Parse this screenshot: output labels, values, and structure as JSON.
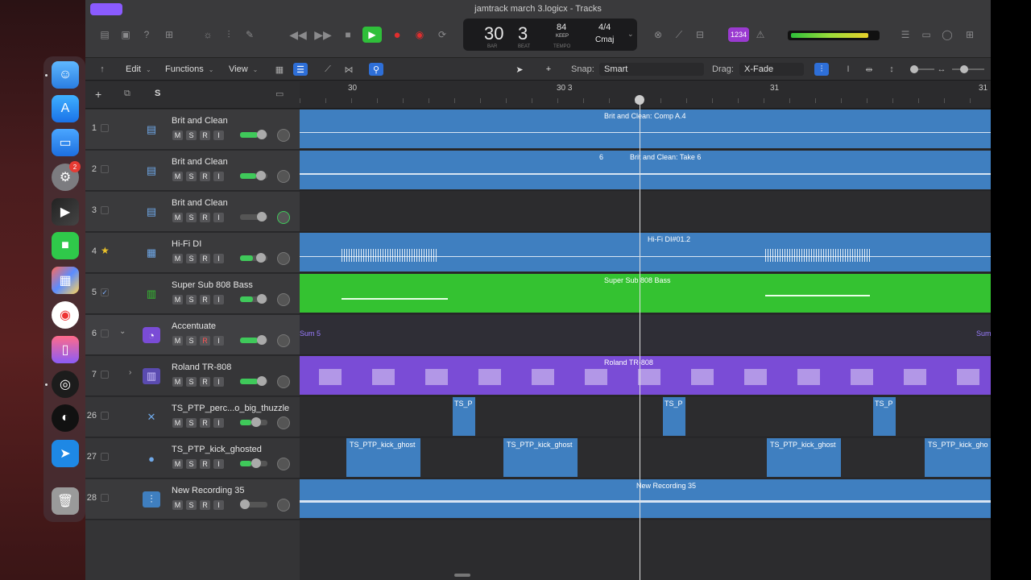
{
  "window": {
    "title": "jamtrack march 3.logicx - Tracks"
  },
  "lcd": {
    "bar": "30",
    "beat": "3",
    "bar_label": "BAR",
    "beat_label": "BEAT",
    "tempo": "84",
    "tempo_mode": "KEEP",
    "tempo_label": "TEMPO",
    "signature": "4/4",
    "key": "Cmaj"
  },
  "count_in": "1234",
  "menus": {
    "edit": "Edit",
    "functions": "Functions",
    "view": "View"
  },
  "snap": {
    "label": "Snap:",
    "value": "Smart"
  },
  "drag": {
    "label": "Drag:",
    "value": "X-Fade"
  },
  "track_header": {
    "add": "+",
    "solo_all": "S"
  },
  "ruler": {
    "marks": [
      "30",
      "30 3",
      "31",
      "31"
    ]
  },
  "tracks": [
    {
      "num": "1",
      "name": "Brit and Clean",
      "region": "Brit and Clean: Comp A.4",
      "checked": false
    },
    {
      "num": "2",
      "name": "Brit and Clean",
      "region": "Brit and Clean: Take 6",
      "take": "6",
      "checked": false
    },
    {
      "num": "3",
      "name": "Brit and Clean",
      "region": "",
      "checked": false
    },
    {
      "num": "4",
      "name": "Hi-Fi DI",
      "region": "Hi-Fi DI#01.2",
      "star": "★",
      "checked": false
    },
    {
      "num": "5",
      "name": "Super Sub 808 Bass",
      "region": "Super Sub 808 Bass",
      "checked": true
    },
    {
      "num": "6",
      "name": "Accentuate",
      "region": "Sum 5",
      "region_end": "Sum",
      "checked": false
    },
    {
      "num": "7",
      "name": "Roland TR-808",
      "region": "Roland TR-808",
      "checked": false
    },
    {
      "num": "26",
      "name": "TS_PTP_perc...o_big_thuzzle",
      "region": "TS_P",
      "checked": false
    },
    {
      "num": "27",
      "name": "TS_PTP_kick_ghosted",
      "region": "TS_PTP_kick_ghost",
      "region_last": "TS_PTP_kick_gho",
      "checked": false
    },
    {
      "num": "28",
      "name": "New Recording 35",
      "region": "New Recording 35",
      "checked": false
    }
  ],
  "msri": {
    "m": "M",
    "s": "S",
    "r": "R",
    "i": "I"
  },
  "colors": {
    "audio_blue": "#3f7fc0",
    "midi_green": "#34c231",
    "drum_purple": "#7a4cd6",
    "sum_purple": "#9a7cff"
  },
  "dock": [
    "finder-icon",
    "app-store-icon",
    "keynote-icon",
    "system-settings-icon",
    "final-cut-pro-icon",
    "facetime-icon",
    "launchpad-icon",
    "chrome-icon",
    "phone-mirroring-icon",
    "logic-pro-icon",
    "obs-icon",
    "send-icon",
    "trash-icon"
  ],
  "dock_badge": "2"
}
